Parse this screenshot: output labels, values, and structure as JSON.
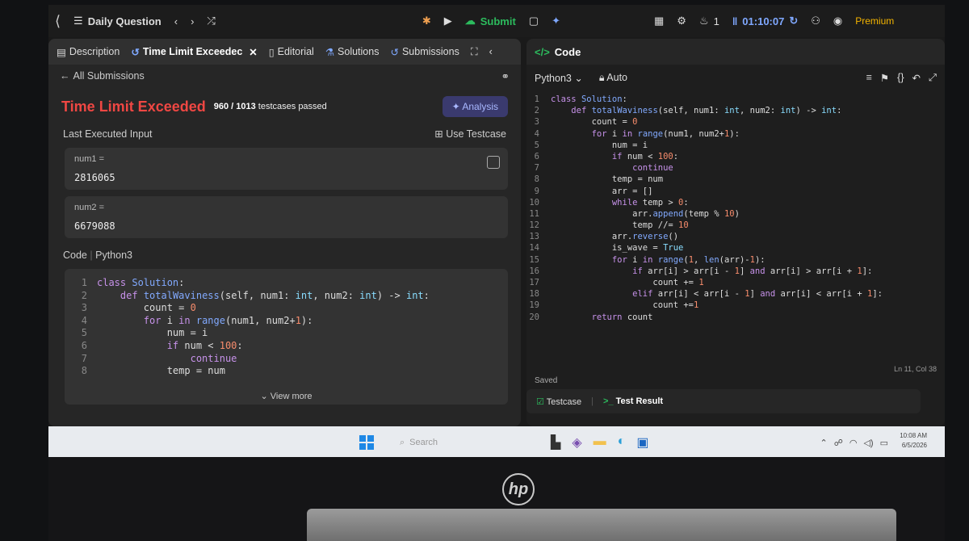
{
  "topbar": {
    "title": "Daily Question",
    "submit": "Submit",
    "runs": "1",
    "timer": "01:10:07",
    "premium": "Premium"
  },
  "tabs": [
    "Description",
    "Time Limit Exceedec",
    "Editorial",
    "Solutions",
    "Submissions"
  ],
  "all_submissions": "All Submissions",
  "result": {
    "status": "Time Limit Exceeded",
    "passed": "960 / 1013",
    "passed_suffix": "testcases passed",
    "analysis": "Analysis"
  },
  "last_input": {
    "heading": "Last Executed Input",
    "use_testcase": "Use Testcase",
    "vars": [
      {
        "name": "num1 =",
        "value": "2816065"
      },
      {
        "name": "num2 =",
        "value": "6679088"
      }
    ]
  },
  "code_section": {
    "heading": "Code",
    "language": "Python3",
    "view_more": "View more"
  },
  "code_preview": [
    {
      "n": "1",
      "text": "class Solution:"
    },
    {
      "n": "2",
      "text": "    def totalWaviness(self, num1: int, num2: int) -> int:"
    },
    {
      "n": "3",
      "text": "        count = 0"
    },
    {
      "n": "4",
      "text": "        for i in range(num1, num2+1):"
    },
    {
      "n": "5",
      "text": "            num = i"
    },
    {
      "n": "6",
      "text": "            if num < 100:"
    },
    {
      "n": "7",
      "text": "                continue"
    },
    {
      "n": "8",
      "text": "            temp = num"
    }
  ],
  "editor": {
    "title": "Code",
    "language": "Python3",
    "mode": "Auto",
    "saved": "Saved",
    "position": "Ln 11, Col 38",
    "lines": [
      {
        "n": "1",
        "text": "class Solution:"
      },
      {
        "n": "2",
        "text": "    def totalWaviness(self, num1: int, num2: int) -> int:"
      },
      {
        "n": "3",
        "text": "        count = 0"
      },
      {
        "n": "4",
        "text": "        for i in range(num1, num2+1):"
      },
      {
        "n": "5",
        "text": "            num = i"
      },
      {
        "n": "6",
        "text": "            if num < 100:"
      },
      {
        "n": "7",
        "text": "                continue"
      },
      {
        "n": "8",
        "text": "            temp = num"
      },
      {
        "n": "9",
        "text": "            arr = []"
      },
      {
        "n": "10",
        "text": "            while temp > 0:"
      },
      {
        "n": "11",
        "text": "                arr.append(temp % 10)"
      },
      {
        "n": "12",
        "text": "                temp //= 10"
      },
      {
        "n": "13",
        "text": "            arr.reverse()"
      },
      {
        "n": "14",
        "text": "            is_wave = True"
      },
      {
        "n": "15",
        "text": "            for i in range(1, len(arr)-1):"
      },
      {
        "n": "16",
        "text": "                if arr[i] > arr[i - 1] and arr[i] > arr[i + 1]:"
      },
      {
        "n": "17",
        "text": "                    count += 1"
      },
      {
        "n": "18",
        "text": "                elif arr[i] < arr[i - 1] and arr[i] < arr[i + 1]:"
      },
      {
        "n": "19",
        "text": "                    count +=1"
      },
      {
        "n": "20",
        "text": "        return count"
      }
    ]
  },
  "bottom_tabs": [
    "Testcase",
    "Test Result"
  ],
  "taskbar": {
    "search": "Search",
    "time": "10:08 AM",
    "date": "6/5/2026"
  },
  "brand": "hp"
}
